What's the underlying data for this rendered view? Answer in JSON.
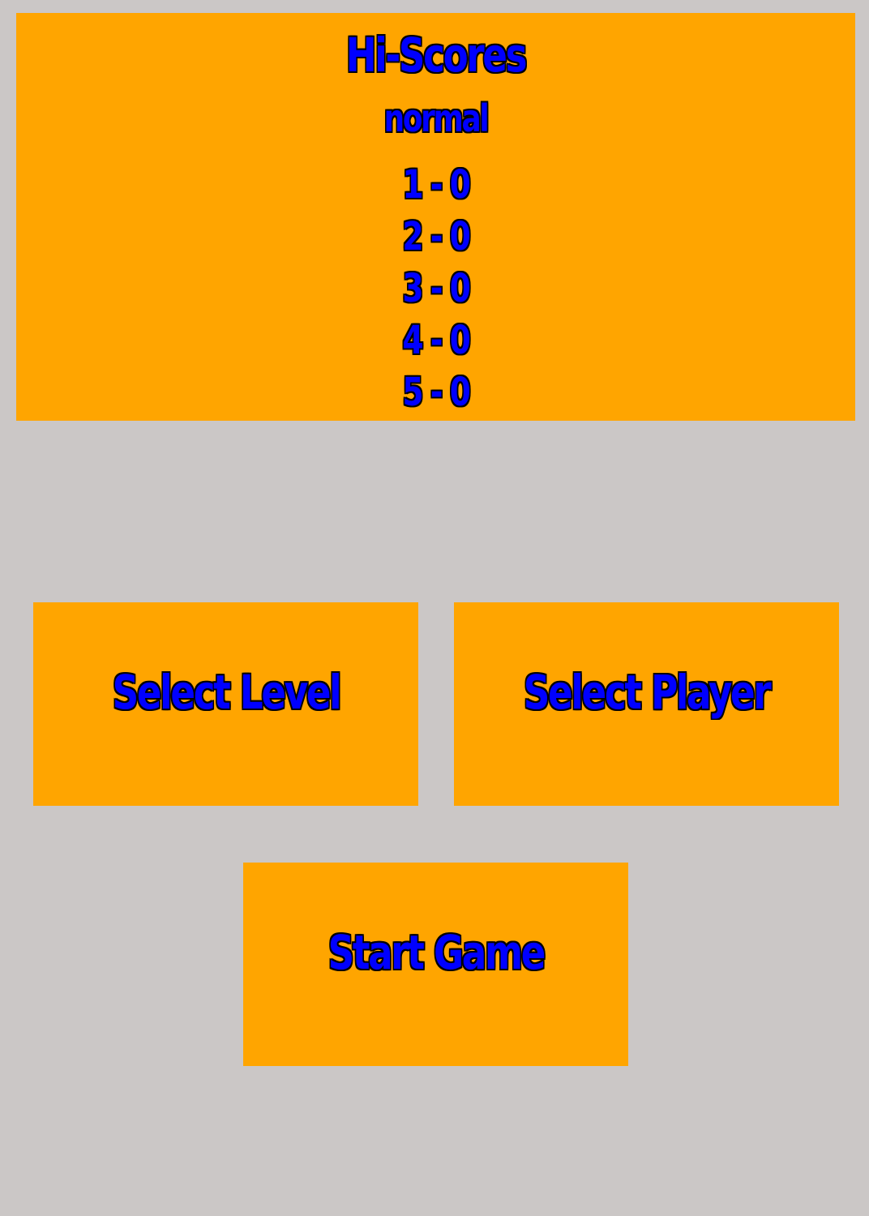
{
  "hiscores": {
    "title": "Hi-Scores",
    "mode": "normal",
    "entries": [
      "1 - 0",
      "2 - 0",
      "3 - 0",
      "4 - 0",
      "5 - 0"
    ]
  },
  "buttons": {
    "select_level": "Select Level",
    "select_player": "Select Player",
    "start_game": "Start Game"
  },
  "colors": {
    "background": "#cbc7c6",
    "panel": "#ffa500",
    "text": "#0000ff",
    "outline": "#000000"
  }
}
